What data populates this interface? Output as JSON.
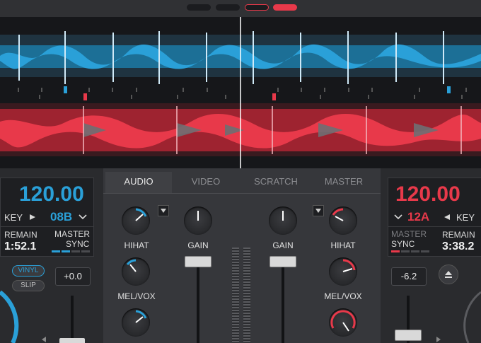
{
  "colors": {
    "left_accent": "#2aa0d8",
    "right_accent": "#e8394a",
    "background": "#2a2b2e",
    "wave_bg": "#16171a"
  },
  "mixer_tabs": [
    {
      "label": "AUDIO",
      "active": true
    },
    {
      "label": "VIDEO",
      "active": false
    },
    {
      "label": "SCRATCH",
      "active": false
    },
    {
      "label": "MASTER",
      "active": false
    }
  ],
  "left_deck": {
    "bpm": "120.00",
    "key_label": "KEY",
    "key_value": "08B",
    "remain_label": "REMAIN",
    "remain_value": "1:52.1",
    "master_label": "MASTER",
    "sync_label": "SYNC",
    "vinyl_label": "VINYL",
    "slip_label": "SLIP",
    "pitch_value": "+0.0"
  },
  "right_deck": {
    "bpm": "120.00",
    "key_label": "KEY",
    "key_value": "12A",
    "remain_label": "REMAIN",
    "remain_value": "3:38.2",
    "master_label": "MASTER",
    "sync_label": "SYNC",
    "pitch_value": "-6.2"
  },
  "mixer": {
    "left_hihat_label": "HIHAT",
    "left_melvox_label": "MEL/VOX",
    "left_gain_label": "GAIN",
    "right_gain_label": "GAIN",
    "right_hihat_label": "HIHAT",
    "right_melvox_label": "MEL/VOX"
  },
  "icons": {
    "play": "play-icon",
    "chevron": "chevron-down-icon",
    "eject": "eject-icon",
    "dropdown": "dropdown-arrow-icon"
  }
}
